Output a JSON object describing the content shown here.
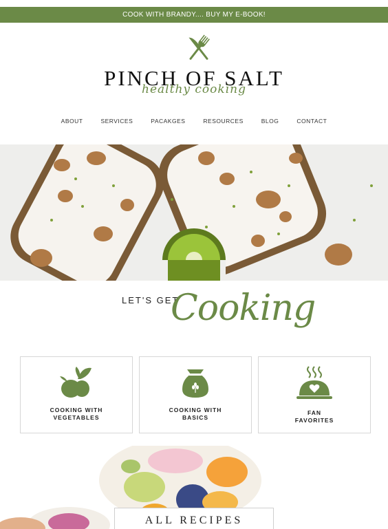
{
  "announcement": "COOK WITH BRANDY.... BUY MY E-BOOK!",
  "brand": {
    "name": "PINCH OF SALT",
    "tagline": "healthy cooking"
  },
  "nav": [
    "ABOUT",
    "SERVICES",
    "PACAKGES",
    "RESOURCES",
    "BLOG",
    "CONTACT"
  ],
  "section": {
    "lead": "LET'S GET",
    "script": "Cooking"
  },
  "cards": [
    {
      "line1": "COOKING WITH",
      "line2": "VEGETABLES",
      "icon": "vegetables-icon"
    },
    {
      "line1": "COOKING WITH",
      "line2": "BASICS",
      "icon": "flour-sack-icon"
    },
    {
      "line1": "FAN",
      "line2": "FAVORITES",
      "icon": "serving-dish-icon"
    }
  ],
  "cta": "ALL RECIPES",
  "colors": {
    "accent": "#6b8a47"
  }
}
